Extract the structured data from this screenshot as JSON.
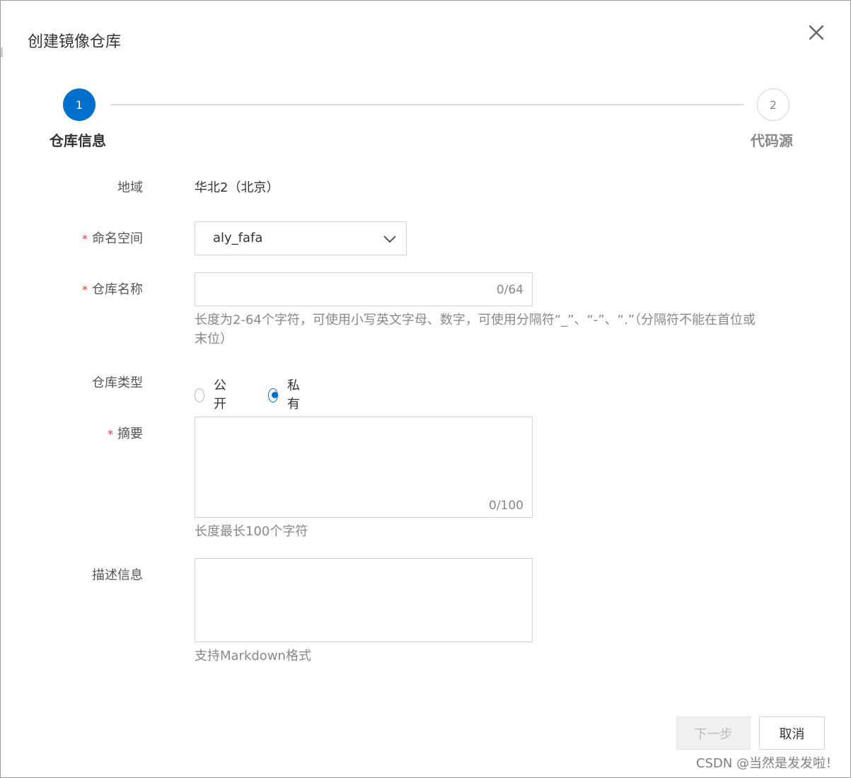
{
  "dialog": {
    "title": "创建镜像仓库",
    "close_icon": "close-icon"
  },
  "steps": [
    {
      "number": "1",
      "label": "仓库信息",
      "state": "active"
    },
    {
      "number": "2",
      "label": "代码源",
      "state": "inactive"
    }
  ],
  "form": {
    "region": {
      "label": "地域",
      "value": "华北2（北京）"
    },
    "namespace": {
      "required_mark": "*",
      "label": "命名空间",
      "value": "aly_fafa"
    },
    "repo_name": {
      "required_mark": "*",
      "label": "仓库名称",
      "value": "",
      "counter": "0/64",
      "hint": "长度为2-64个字符，可使用小写英文字母、数字，可使用分隔符“_”、“-”、“.”（分隔符不能在首位或末位）"
    },
    "repo_type": {
      "label": "仓库类型",
      "options": [
        {
          "label": "公开",
          "checked": false
        },
        {
          "label": "私有",
          "checked": true
        }
      ]
    },
    "summary": {
      "required_mark": "*",
      "label": "摘要",
      "value": "",
      "counter": "0/100",
      "hint": "长度最长100个字符"
    },
    "description": {
      "label": "描述信息",
      "value": "",
      "hint": "支持Markdown格式"
    }
  },
  "footer": {
    "next_label": "下一步",
    "cancel_label": "取消"
  },
  "watermark": "CSDN @当然是发发啦！",
  "colors": {
    "primary": "#0070cc",
    "required": "#e4393c",
    "hint_text": "#888888",
    "border": "#d5d5d5"
  }
}
